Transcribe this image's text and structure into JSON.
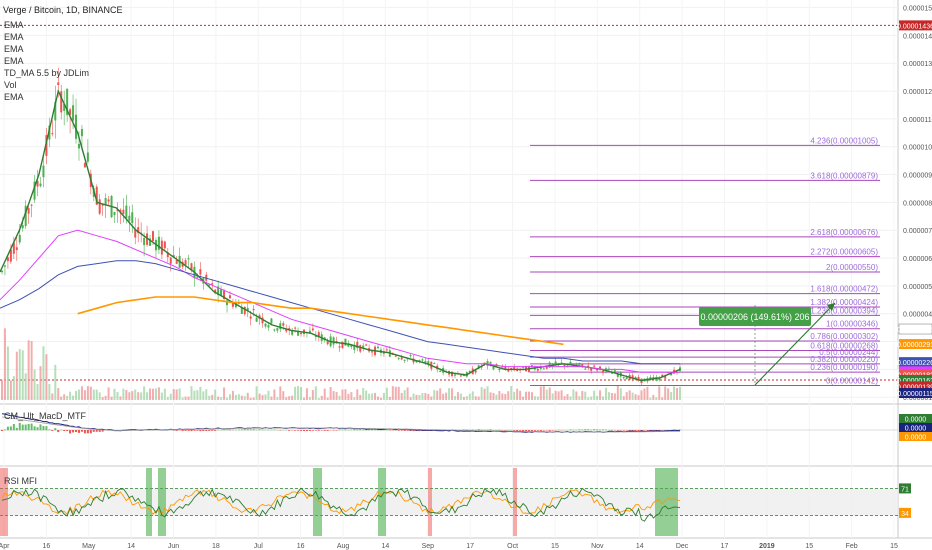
{
  "header": {
    "title": "Verge / Bitcoin, 1D, BINANCE",
    "indicators": [
      "EMA",
      "EMA",
      "EMA",
      "EMA",
      "TD_MA 5.5 by JDLim",
      "Vol",
      "EMA"
    ]
  },
  "panes": {
    "macd_label": "CM_Ult_MacD_MTF",
    "rsi_label": "RSI MFI"
  },
  "measure_label": "0.00000206 (149.61%) 206",
  "price_labels": [
    {
      "text": "0.00001436",
      "value": 1.436e-05,
      "color": "#c62828"
    },
    {
      "text": "0.00000345",
      "value": 3.45e-06,
      "color": "#ffffff",
      "textColor": "#333333",
      "border": "#888888"
    },
    {
      "text": "0.00000291",
      "value": 2.91e-06,
      "color": "#ff9800"
    },
    {
      "text": "0.00000226",
      "value": 2.26e-06,
      "color": "#3f51b5"
    },
    {
      "text": "0.00000193",
      "value": 1.93e-06,
      "color": "#e040fb"
    },
    {
      "text": "0.00000182",
      "value": 1.82e-06,
      "color": "#ef5350"
    },
    {
      "text": "0.00000162",
      "value": 1.62e-06,
      "color": "#2e7d32"
    },
    {
      "text": "0.00000139",
      "value": 1.39e-06,
      "color": "#c62828"
    },
    {
      "text": "0.00000115",
      "value": 1.15e-06,
      "color": "#1a237e"
    }
  ],
  "macd_labels": [
    {
      "text": "0.0000",
      "color": "#2e7d32"
    },
    {
      "text": "0.0000",
      "color": "#1a237e"
    },
    {
      "text": "0.0000",
      "color": "#ff9800"
    }
  ],
  "rsi_labels": [
    {
      "text": "71",
      "color": "#2e7d32"
    },
    {
      "text": "34",
      "color": "#ff9800"
    }
  ],
  "x_axis": [
    "Apr",
    "16",
    "May",
    "14",
    "Jun",
    "18",
    "Jul",
    "16",
    "Aug",
    "14",
    "Sep",
    "17",
    "Oct",
    "15",
    "Nov",
    "14",
    "Dec",
    "17",
    "2019",
    "15",
    "Feb",
    "15"
  ],
  "chart_data": {
    "type": "line",
    "title": "Verge / Bitcoin, 1D, BINANCE",
    "y_axis_ticks": [
      "0.00001500",
      "0.00001400",
      "0.00001300",
      "0.00001200",
      "0.00001100",
      "0.00001000",
      "0.00000900",
      "0.00000800",
      "0.00000700",
      "0.00000600",
      "0.00000500",
      "0.00000400",
      "0.00000300",
      "0.00000200",
      "0.00000100"
    ],
    "ylim": [
      9e-07,
      1.52e-05
    ],
    "series": [
      {
        "values": [
          5.5e-06,
          7e-06,
          9e-06,
          1.2e-05,
          1.05e-05,
          8e-06,
          7.8e-06,
          7e-06,
          6.5e-06,
          6e-06,
          5.5e-06,
          4.8e-06,
          4.4e-06,
          4e-06,
          3.6e-06,
          3.4e-06,
          3.3e-06,
          3e-06,
          2.9e-06,
          2.7e-06,
          2.6e-06,
          2.4e-06,
          2.2e-06,
          1.9e-06,
          1.8e-06,
          2.2e-06,
          2e-06,
          2e-06,
          2.1e-06,
          2.2e-06,
          2.1e-06,
          2e-06,
          1.8e-06,
          1.6e-06,
          1.7e-06,
          2e-06
        ]
      },
      {
        "values": [
          4.5e-06,
          5.2e-06,
          6e-06,
          6.8e-06,
          7e-06,
          6.8e-06,
          6.6e-06,
          6.3e-06,
          6e-06,
          5.7e-06,
          5.3e-06,
          5e-06,
          4.7e-06,
          4.4e-06,
          4.1e-06,
          3.8e-06,
          3.6e-06,
          3.4e-06,
          3.2e-06,
          3e-06,
          2.8e-06,
          2.6e-06,
          2.4e-06,
          2.3e-06,
          2.2e-06,
          2.2e-06,
          2.1e-06,
          2.1e-06,
          2.1e-06,
          2.1e-06,
          2.1e-06,
          2e-06,
          2e-06,
          1.9e-06,
          1.9e-06,
          1.9e-06
        ]
      },
      {
        "values": [
          4.2e-06,
          4.5e-06,
          4.9e-06,
          5.4e-06,
          5.7e-06,
          5.8e-06,
          5.9e-06,
          5.9e-06,
          5.8e-06,
          5.6e-06,
          5.4e-06,
          5.2e-06,
          5e-06,
          4.8e-06,
          4.6e-06,
          4.4e-06,
          4.2e-06,
          4e-06,
          3.8e-06,
          3.6e-06,
          3.4e-06,
          3.2e-06,
          3e-06,
          2.9e-06,
          2.8e-06,
          2.7e-06,
          2.6e-06,
          2.5e-06,
          2.4e-06,
          2.4e-06,
          2.3e-06,
          2.3e-06,
          2.3e-06,
          2.2e-06,
          2.2e-06,
          2.2e-06
        ]
      },
      {
        "values": [
          null,
          null,
          null,
          null,
          4e-06,
          4.2e-06,
          4.4e-06,
          4.5e-06,
          4.6e-06,
          4.6e-06,
          4.6e-06,
          4.5e-06,
          4.4e-06,
          4.4e-06,
          4.3e-06,
          4.2e-06,
          4.2e-06,
          4.1e-06,
          4e-06,
          3.9e-06,
          3.8e-06,
          3.7e-06,
          3.6e-06,
          3.5e-06,
          3.4e-06,
          3.3e-06,
          3.2e-06,
          3.1e-06,
          3e-06,
          2.9e-06,
          null,
          null,
          null,
          null,
          null,
          null
        ]
      }
    ],
    "fib_levels": [
      {
        "label": "4.236(0.00001005)",
        "value": 1.005e-05
      },
      {
        "label": "3.618(0.00000879)",
        "value": 8.79e-06
      },
      {
        "label": "2.618(0.00000676)",
        "value": 6.76e-06
      },
      {
        "label": "2.272(0.00000605)",
        "value": 6.05e-06
      },
      {
        "label": "2(0.00000550)",
        "value": 5.5e-06
      },
      {
        "label": "1.618(0.00000472)",
        "value": 4.72e-06
      },
      {
        "label": "1.382(0.00000424)",
        "value": 4.24e-06
      },
      {
        "label": "1.236(0.00000394)",
        "value": 3.94e-06
      },
      {
        "label": "1(0.00000346)",
        "value": 3.46e-06
      },
      {
        "label": "0.786(0.00000302)",
        "value": 3.02e-06
      },
      {
        "label": "0.618(0.00000268)",
        "value": 2.68e-06
      },
      {
        "label": "0.5(0.00000244)",
        "value": 2.44e-06
      },
      {
        "label": "0.382(0.00000220)",
        "value": 2.2e-06
      },
      {
        "label": "0.236(0.00000190)",
        "value": 1.9e-06
      },
      {
        "label": "0(0.00000142)",
        "value": 1.42e-06
      }
    ],
    "high_line": 1.436e-05,
    "low_line": 1.62e-06
  }
}
